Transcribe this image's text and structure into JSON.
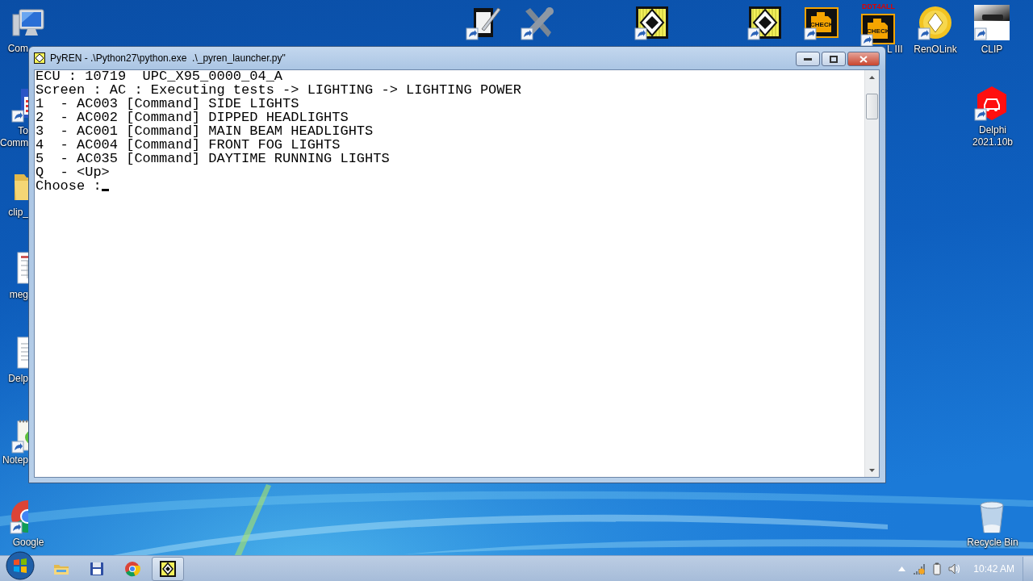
{
  "desktop": {
    "icons": [
      {
        "kind": "computer",
        "label": "Com",
        "shortcut": false
      },
      {
        "kind": "commander",
        "label": "To Comm",
        "shortcut": true
      },
      {
        "kind": "folder",
        "label": "clip_",
        "shortcut": false
      },
      {
        "kind": "sheet",
        "label": "meg",
        "shortcut": false
      },
      {
        "kind": "document",
        "label": "Delp",
        "shortcut": false
      },
      {
        "kind": "notepad",
        "label": "Notep",
        "shortcut": true
      },
      {
        "kind": "chrome",
        "label": "Google",
        "shortcut": true
      },
      {
        "kind": "delphi",
        "label": "Delphi 2021.10b",
        "shortcut": true
      },
      {
        "kind": "recycle",
        "label": "Recycle Bin",
        "shortcut": false
      },
      {
        "kind": "tablet",
        "shortcut": true
      },
      {
        "kind": "tools",
        "shortcut": true
      },
      {
        "kind": "renault",
        "shortcut": true
      },
      {
        "kind": "renault",
        "shortcut": true
      },
      {
        "kind": "check",
        "caption": "CHECK",
        "shortcut": true
      },
      {
        "kind": "check",
        "caption": "CHECK",
        "banner": "DDT4ALL",
        "label": "L III",
        "shortcut": true
      },
      {
        "kind": "renolink",
        "label": "RenOLink",
        "shortcut": true
      },
      {
        "kind": "clip",
        "label": "CLIP",
        "shortcut": true
      }
    ]
  },
  "window": {
    "title": "PyREN - .\\Python27\\python.exe  .\\_pyren_launcher.py\"",
    "lines": [
      "ECU : 10719  UPC_X95_0000_04_A",
      "Screen : AC : Executing tests -> LIGHTING -> LIGHTING POWER",
      "1  - AC003 [Command] SIDE LIGHTS",
      "2  - AC002 [Command] DIPPED HEADLIGHTS",
      "3  - AC001 [Command] MAIN BEAM HEADLIGHTS",
      "4  - AC004 [Command] FRONT FOG LIGHTS",
      "5  - AC035 [Command] DAYTIME RUNNING LIGHTS",
      "Q  - <Up>",
      "Choose :"
    ]
  },
  "taskbar": {
    "items": [
      {
        "kind": "explorer",
        "selected": false
      },
      {
        "kind": "floppy",
        "selected": false
      },
      {
        "kind": "chrome",
        "selected": false
      },
      {
        "kind": "renault",
        "selected": true
      }
    ],
    "clock": "10:42 AM"
  }
}
